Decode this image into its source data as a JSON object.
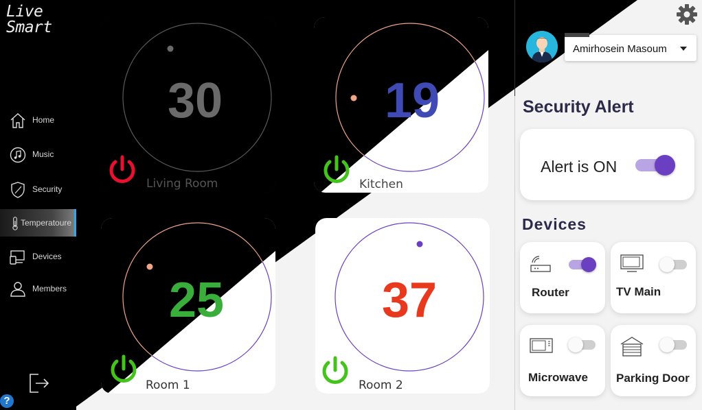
{
  "app": {
    "logo_line1": "Live",
    "logo_line2": "Smart"
  },
  "sidebar": {
    "items": [
      {
        "label": "Home",
        "icon": "home-icon"
      },
      {
        "label": "Music",
        "icon": "music-icon"
      },
      {
        "label": "Security",
        "icon": "shield-icon"
      },
      {
        "label": "Temperatoure",
        "icon": "thermometer-icon",
        "active": true
      },
      {
        "label": "Devices",
        "icon": "devices-icon"
      },
      {
        "label": "Members",
        "icon": "members-icon"
      }
    ],
    "logout_icon": "logout-icon",
    "help_label": "?"
  },
  "thermostats": [
    {
      "room": "Living Room",
      "value": "30",
      "value_color": "#6a6a6a",
      "power_color": "#e8102e",
      "ring_color": "#666666"
    },
    {
      "room": "Kitchen",
      "value": "19",
      "value_color": "#3f4ab5",
      "power_color": "#44c31a",
      "ring_color": "#f0a48a"
    },
    {
      "room": "Room 1",
      "value": "25",
      "value_color": "#3aae3a",
      "power_color": "#44c31a",
      "ring_color": "#f0a48a"
    },
    {
      "room": "Room 2",
      "value": "37",
      "value_color": "#e8391f",
      "power_color": "#44c31a",
      "ring_color": "#6a3fc2"
    }
  ],
  "user": {
    "name": "Amirhosein Masoum"
  },
  "security": {
    "title": "Security Alert",
    "status_text": "Alert is ON",
    "toggle_on": true
  },
  "devices": {
    "title": "Devices",
    "items": [
      {
        "label": "Router",
        "icon": "router-icon",
        "on": true
      },
      {
        "label": "TV Main",
        "icon": "tv-icon",
        "on": false
      },
      {
        "label": "Microwave",
        "icon": "microwave-icon",
        "on": false
      },
      {
        "label": "Parking Door",
        "icon": "garage-door-icon",
        "on": false
      }
    ]
  },
  "colors": {
    "accent": "#6a3fc2",
    "accent_light": "#b9a5e3",
    "active_indicator": "#2ea8e6"
  }
}
